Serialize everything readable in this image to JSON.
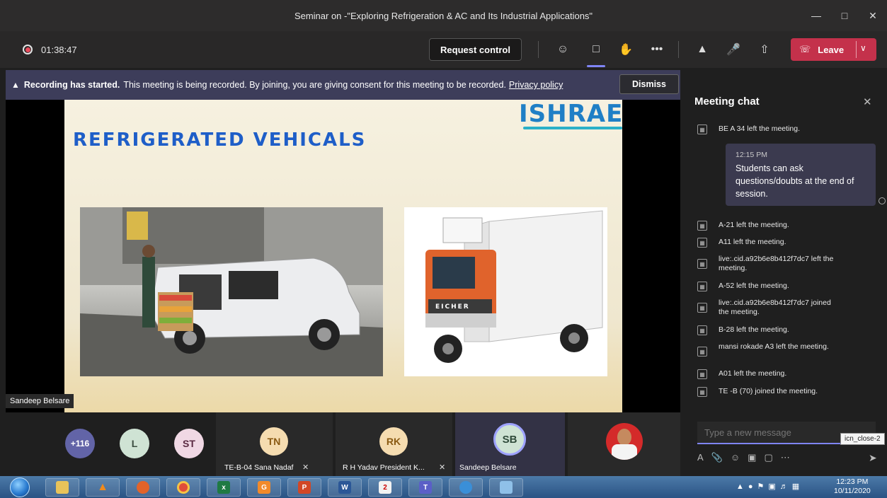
{
  "window": {
    "title": "Seminar on -\"Exploring Refrigeration & AC and Its Industrial Applications\"",
    "minimize_icon": "minimize-icon",
    "maximize_icon": "maximize-icon",
    "close_icon": "close-icon"
  },
  "toolbar": {
    "timer": "01:38:47",
    "request_control": "Request control",
    "leave_label": "Leave",
    "icons": [
      "people-icon",
      "chat-icon",
      "raise-hand-icon",
      "more-icon",
      "camera-off-icon",
      "mic-off-icon",
      "share-icon"
    ]
  },
  "banner": {
    "bold": "Recording has started.",
    "text": "This meeting is being recorded. By joining, you are giving consent for this meeting to be recorded.",
    "link": "Privacy policy",
    "dismiss": "Dismiss"
  },
  "slide": {
    "title": "REFRIGERATED VEHICALS",
    "logo_text": "ISHRAE",
    "truck_badge": "EICHER"
  },
  "presenter_label": "Sandeep Belsare",
  "chat": {
    "header": "Meeting chat",
    "events_top": [
      {
        "text": "BE A 34 left the meeting."
      }
    ],
    "message": {
      "time": "12:15 PM",
      "text": "Students can ask questions/doubts at the end of session."
    },
    "events": [
      {
        "text": "A-21 left the meeting."
      },
      {
        "text": "A11 left the meeting."
      },
      {
        "text": "live:.cid.a92b6e8b412f7dc7 left the meeting."
      },
      {
        "text": "A-52 left the meeting."
      },
      {
        "text": "live:.cid.a92b6e8b412f7dc7 joined the meeting."
      },
      {
        "text": "B-28 left the meeting."
      },
      {
        "text": "mansi rokade A3 left the meeting."
      },
      {
        "text": "A01 left the meeting."
      },
      {
        "text": "TE -B (70) joined the meeting."
      }
    ],
    "compose_placeholder": "Type a new message",
    "tooltip": "icn_close-2"
  },
  "participants": {
    "overflow": "+116",
    "avatars": [
      {
        "initials": "L"
      },
      {
        "initials": "ST"
      }
    ],
    "tiles": [
      {
        "initials": "TN",
        "name": "TE-B-04 Sana Nadaf"
      },
      {
        "initials": "RK",
        "name": "R H Yadav President K..."
      },
      {
        "initials": "SB",
        "name": "Sandeep Belsare"
      }
    ]
  },
  "taskbar": {
    "clock_time": "12:23 PM",
    "clock_date": "10/11/2020",
    "apps": [
      "file-explorer-icon",
      "vlc-icon",
      "firefox-icon",
      "chrome-icon",
      "excel-icon",
      "pdf-icon",
      "powerpoint-icon",
      "word-icon",
      "notes-icon",
      "teams-icon",
      "onedrive-icon",
      "photos-icon"
    ]
  }
}
